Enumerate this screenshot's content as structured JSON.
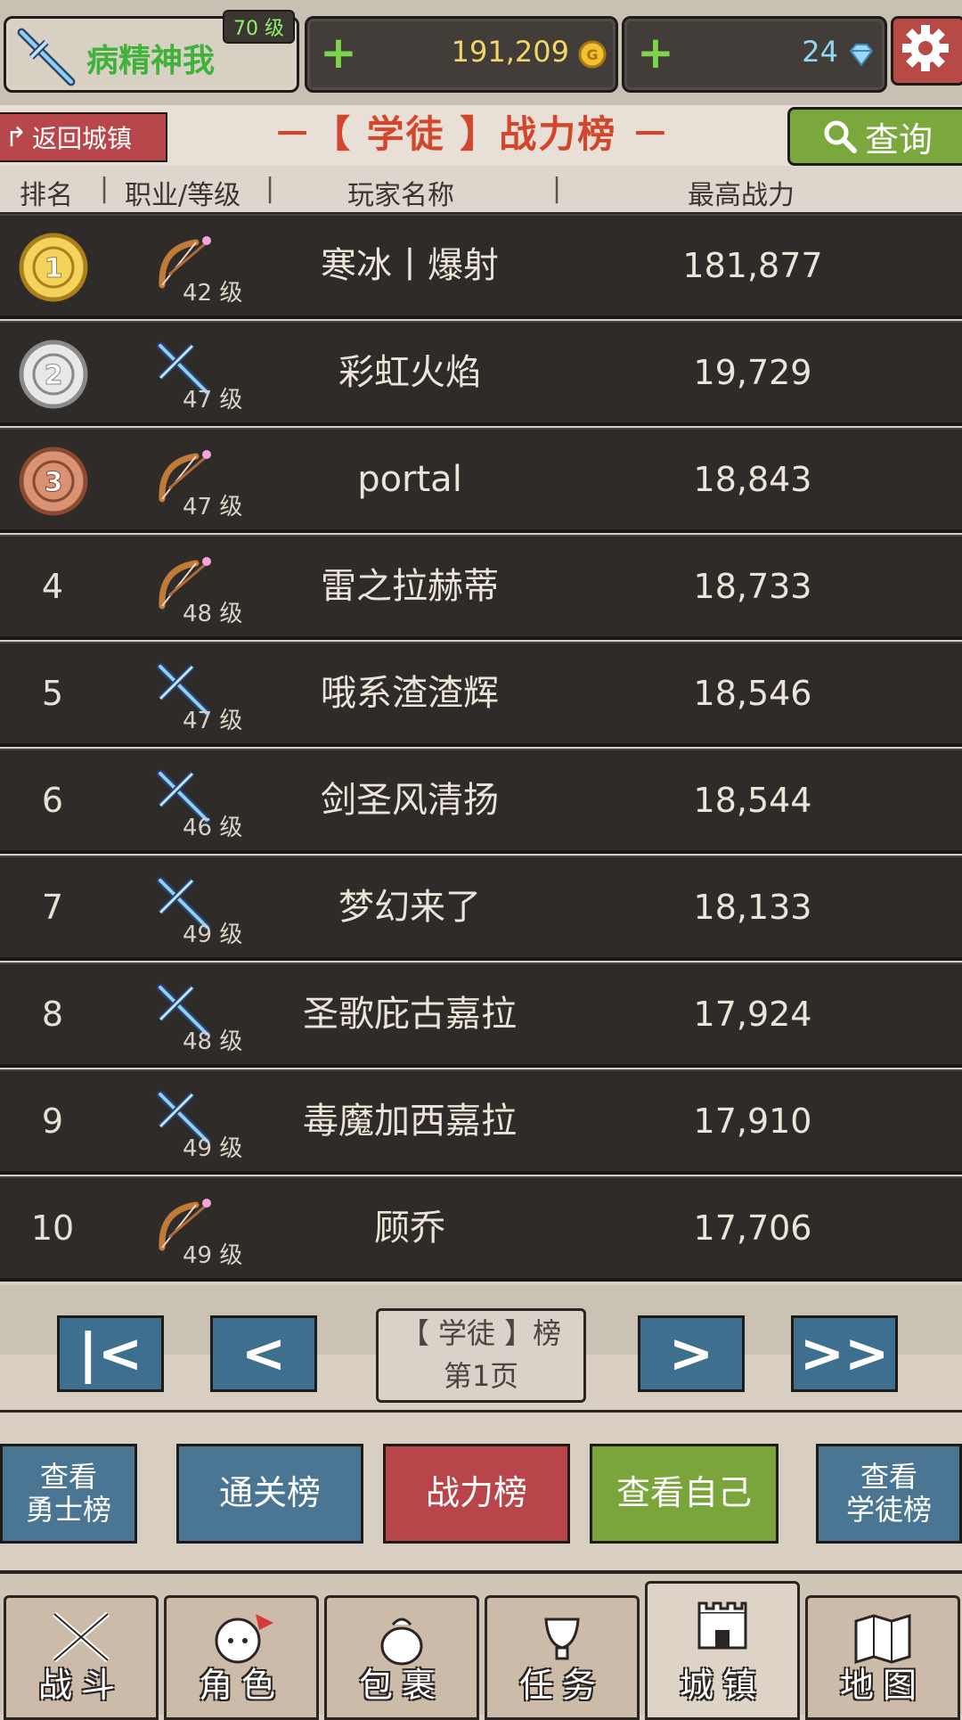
{
  "player": {
    "level": "70 级",
    "name": "病精神我"
  },
  "currency": {
    "gold": "191,209",
    "gems": "24"
  },
  "nav_top": {
    "back": "返回城镇",
    "title": "－【 学徒 】战力榜 －",
    "query": "查询"
  },
  "columns": {
    "rank": "排名",
    "job_level": "职业/等级",
    "player_name": "玩家名称",
    "max_power": "最高战力",
    "sep": "|"
  },
  "rows": [
    {
      "rank": "1",
      "job": "bow",
      "level": "42",
      "lvl_suffix": "级",
      "name": "寒冰丨爆射",
      "power": "181,877",
      "medal": "gold"
    },
    {
      "rank": "2",
      "job": "sword",
      "level": "47",
      "lvl_suffix": "级",
      "name": "彩虹火焰",
      "power": "19,729",
      "medal": "silver"
    },
    {
      "rank": "3",
      "job": "bow",
      "level": "47",
      "lvl_suffix": "级",
      "name": "portal",
      "power": "18,843",
      "medal": "bronze"
    },
    {
      "rank": "4",
      "job": "bow",
      "level": "48",
      "lvl_suffix": "级",
      "name": "雷之拉赫蒂",
      "power": "18,733"
    },
    {
      "rank": "5",
      "job": "sword",
      "level": "47",
      "lvl_suffix": "级",
      "name": "哦系渣渣辉",
      "power": "18,546"
    },
    {
      "rank": "6",
      "job": "sword",
      "level": "46",
      "lvl_suffix": "级",
      "name": "剑圣风清扬",
      "power": "18,544"
    },
    {
      "rank": "7",
      "job": "sword",
      "level": "49",
      "lvl_suffix": "级",
      "name": "梦幻来了",
      "power": "18,133"
    },
    {
      "rank": "8",
      "job": "sword",
      "level": "48",
      "lvl_suffix": "级",
      "name": "圣歌庇古嘉拉",
      "power": "17,924"
    },
    {
      "rank": "9",
      "job": "sword",
      "level": "49",
      "lvl_suffix": "级",
      "name": "毒魔加西嘉拉",
      "power": "17,910"
    },
    {
      "rank": "10",
      "job": "bow",
      "level": "49",
      "lvl_suffix": "级",
      "name": "顾乔",
      "power": "17,706"
    }
  ],
  "pagination": {
    "board": "【 学徒 】榜",
    "page": "第1页",
    "first": "|<",
    "prev": "<",
    "next": ">",
    "last": ">>"
  },
  "tabs": {
    "warrior": [
      "查看",
      "勇士榜"
    ],
    "clear": "通关榜",
    "power": "战力榜",
    "self": "查看自己",
    "apprentice": [
      "查看",
      "学徒榜"
    ]
  },
  "bottom_nav": [
    {
      "label": "战斗",
      "icon": "crossed-swords-icon"
    },
    {
      "label": "角色",
      "icon": "character-face-icon"
    },
    {
      "label": "包裹",
      "icon": "bag-icon"
    },
    {
      "label": "任务",
      "icon": "quest-cup-icon"
    },
    {
      "label": "城镇",
      "icon": "castle-icon"
    },
    {
      "label": "地图",
      "icon": "map-icon"
    }
  ],
  "colors": {
    "accent_red": "#b84549",
    "accent_green": "#7aa53b",
    "accent_blue": "#4a7694",
    "title": "#d4462b"
  }
}
